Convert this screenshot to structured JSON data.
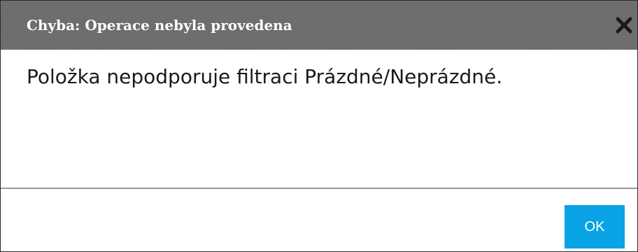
{
  "dialog": {
    "title": "Chyba: Operace nebyla provedena",
    "close_icon": "close-icon",
    "message": "Položka nepodporuje filtraci Prázdné/Neprázdné.",
    "ok_label": "OK"
  },
  "colors": {
    "titlebar": "#6b6b6b",
    "title_text": "#ffffff",
    "ok_button": "#0aa3e6",
    "divider": "#9a9a9a"
  }
}
